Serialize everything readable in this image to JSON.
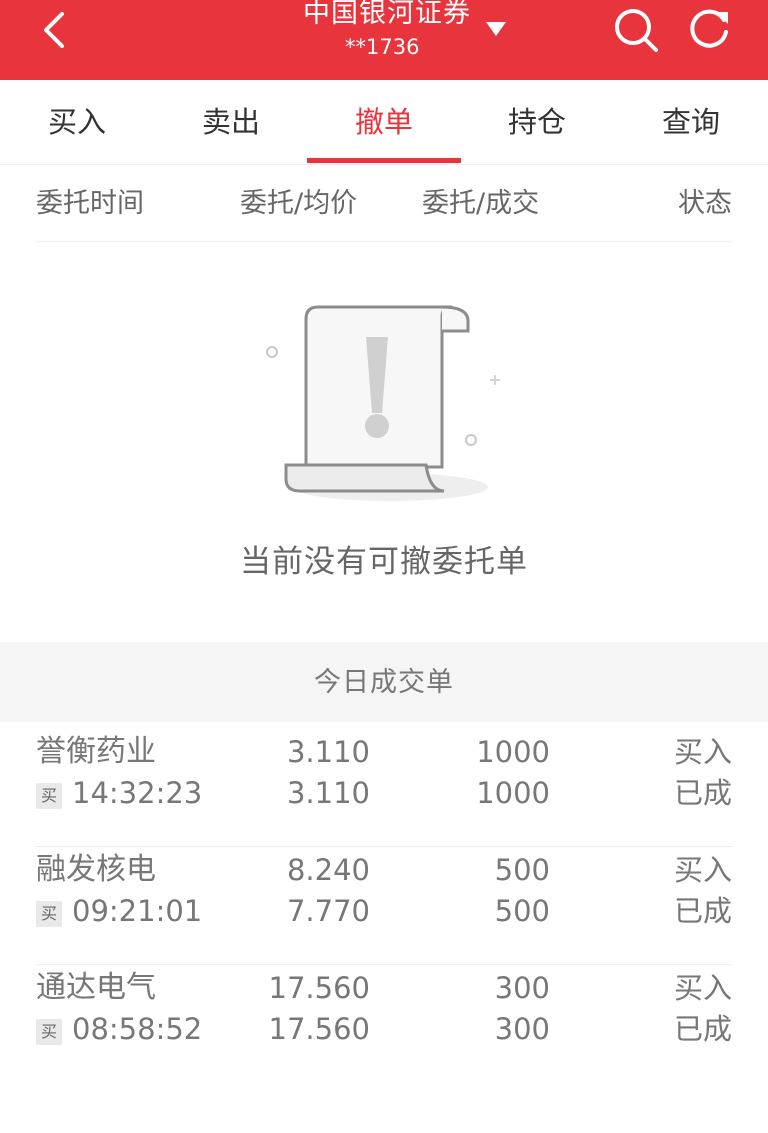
{
  "header": {
    "title": "中国银河证券",
    "account": "**1736",
    "icons": {
      "back": "chevron-left-icon",
      "dropdown": "triangle-down-icon",
      "search": "search-icon",
      "refresh": "refresh-icon"
    },
    "color": "#e8343c"
  },
  "tabs": [
    {
      "label": "买入",
      "active": false
    },
    {
      "label": "卖出",
      "active": false
    },
    {
      "label": "撤单",
      "active": true
    },
    {
      "label": "持仓",
      "active": false
    },
    {
      "label": "查询",
      "active": false
    }
  ],
  "columns": [
    "委托时间",
    "委托/均价",
    "委托/成交",
    "状态"
  ],
  "empty_state": {
    "message": "当前没有可撤委托单",
    "icon": "empty-scroll-icon"
  },
  "today_deals": {
    "title": "今日成交单",
    "rows": [
      {
        "name": "誉衡药业",
        "badge": "买",
        "time": "14:32:23",
        "order_price": "3.110",
        "avg_price": "3.110",
        "order_qty": "1000",
        "deal_qty": "1000",
        "direction": "买入",
        "status": "已成"
      },
      {
        "name": "融发核电",
        "badge": "买",
        "time": "09:21:01",
        "order_price": "8.240",
        "avg_price": "7.770",
        "order_qty": "500",
        "deal_qty": "500",
        "direction": "买入",
        "status": "已成"
      },
      {
        "name": "通达电气",
        "badge": "买",
        "time": "08:58:52",
        "order_price": "17.560",
        "avg_price": "17.560",
        "order_qty": "300",
        "deal_qty": "300",
        "direction": "买入",
        "status": "已成"
      }
    ]
  }
}
